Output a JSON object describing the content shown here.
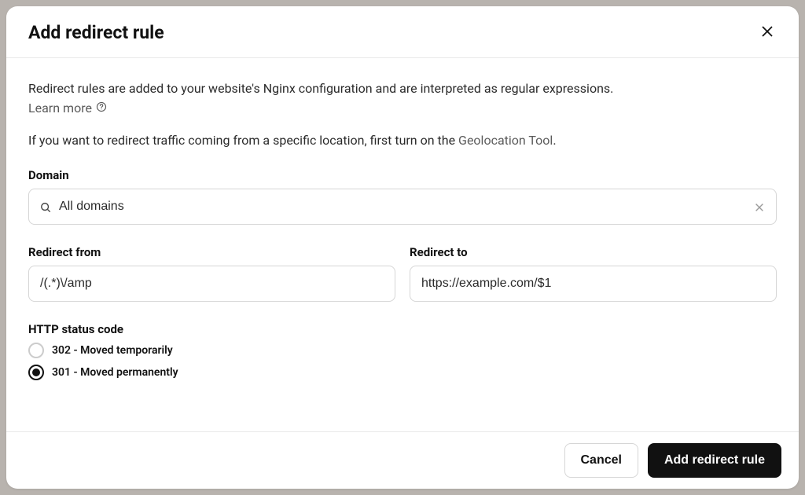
{
  "header": {
    "title": "Add redirect rule"
  },
  "body": {
    "intro": "Redirect rules are added to your website's Nginx configuration and are interpreted as regular expressions.",
    "learn_more": "Learn more",
    "geo_line_prefix": "If you want to redirect traffic coming from a specific location, first turn on the ",
    "geo_link": "Geolocation Tool",
    "geo_line_suffix": "."
  },
  "domain": {
    "label": "Domain",
    "value": "All domains"
  },
  "redirect_from": {
    "label": "Redirect from",
    "value": "/(.*)\\/amp"
  },
  "redirect_to": {
    "label": "Redirect to",
    "value": "https://example.com/$1"
  },
  "status": {
    "label": "HTTP status code",
    "options": [
      {
        "label": "302 - Moved temporarily",
        "selected": false
      },
      {
        "label": "301 - Moved permanently",
        "selected": true
      }
    ]
  },
  "footer": {
    "cancel": "Cancel",
    "submit": "Add redirect rule"
  }
}
